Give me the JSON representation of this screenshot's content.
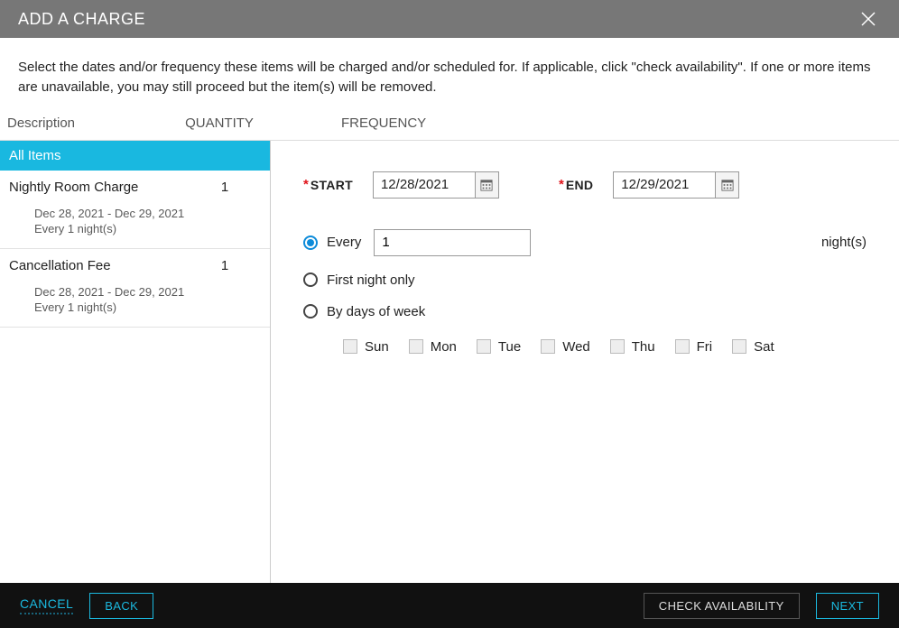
{
  "title": "ADD A CHARGE",
  "instructions": "Select the dates and/or frequency these items will be charged and/or scheduled for. If applicable, click \"check availability\". If one or more items are unavailable, you may still proceed but the item(s) will be removed.",
  "headers": {
    "description": "Description",
    "quantity": "QUANTITY",
    "frequency": "FREQUENCY"
  },
  "sidebar": {
    "all_items": "All Items",
    "items": [
      {
        "name": "Nightly Room Charge",
        "qty": "1",
        "date_range": "Dec 28, 2021 - Dec 29, 2021",
        "freq": "Every 1 night(s)"
      },
      {
        "name": "Cancellation Fee",
        "qty": "1",
        "date_range": "Dec 28, 2021 - Dec 29, 2021",
        "freq": "Every 1 night(s)"
      }
    ]
  },
  "form": {
    "start_label": "START",
    "start_value": "12/28/2021",
    "end_label": "END",
    "end_value": "12/29/2021",
    "every_label": "Every",
    "every_value": "1",
    "nights_label": "night(s)",
    "first_night_label": "First night only",
    "by_dow_label": "By days of week",
    "dow": [
      "Sun",
      "Mon",
      "Tue",
      "Wed",
      "Thu",
      "Fri",
      "Sat"
    ]
  },
  "footer": {
    "cancel": "CANCEL",
    "back": "BACK",
    "check": "CHECK AVAILABILITY",
    "next": "NEXT"
  }
}
